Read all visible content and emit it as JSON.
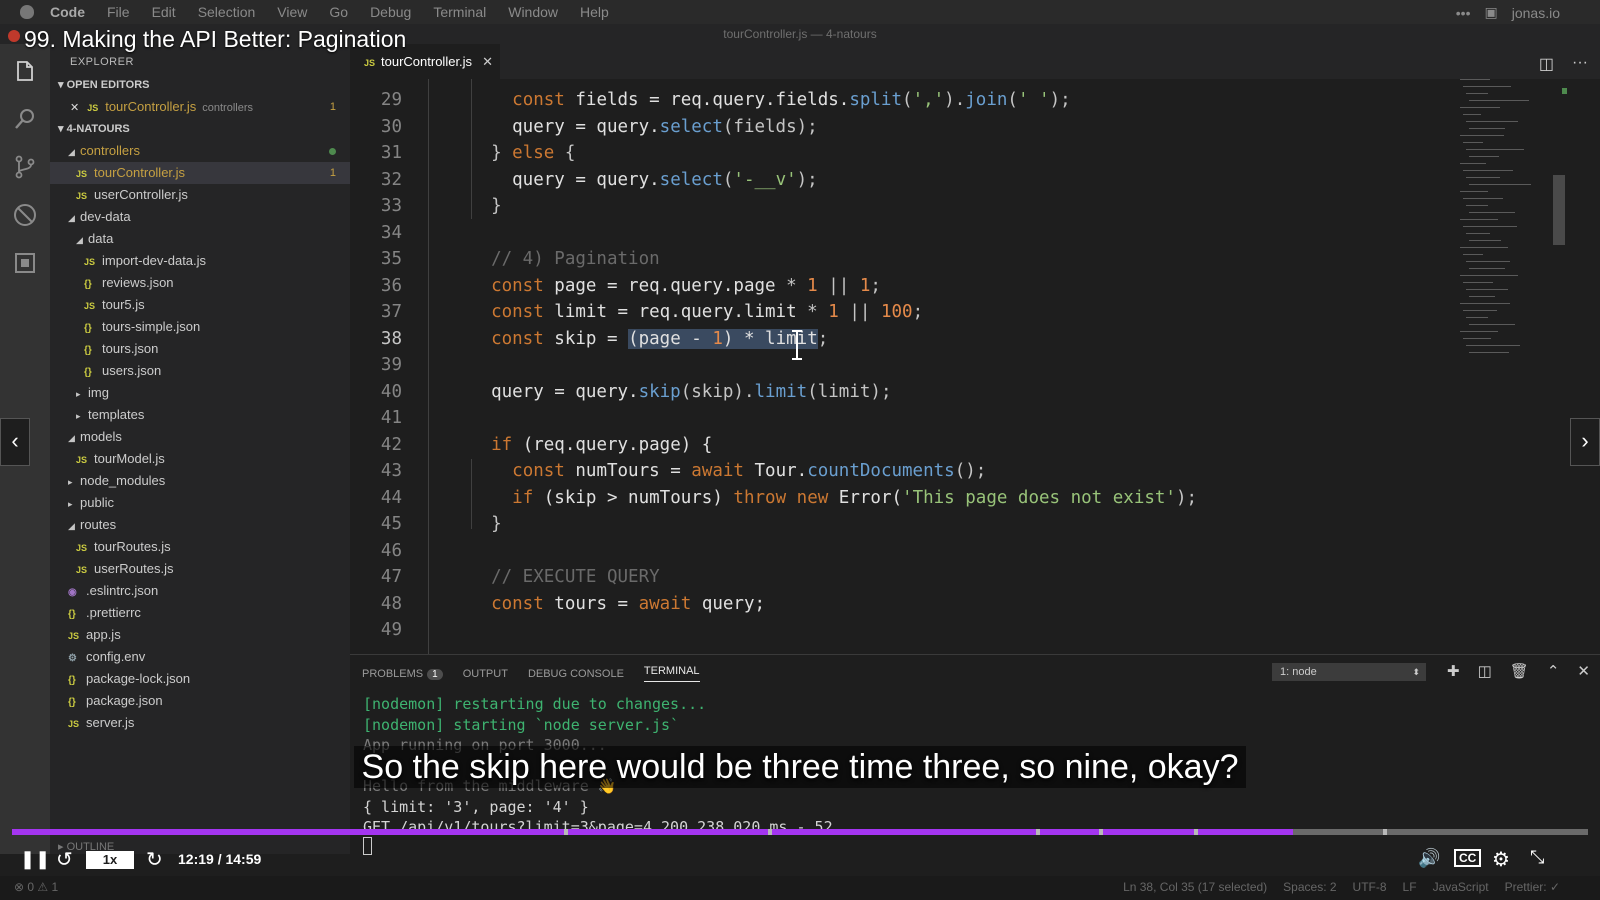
{
  "menubar": {
    "app": "Code",
    "items": [
      "File",
      "Edit",
      "Selection",
      "View",
      "Go",
      "Debug",
      "Terminal",
      "Window",
      "Help"
    ],
    "right_label": "jonas.io"
  },
  "window_title": "tourController.js — 4-natours",
  "video_title": "99. Making the API Better: Pagination",
  "sidebar": {
    "header": "EXPLORER",
    "open_editors_label": "OPEN EDITORS",
    "open_editors": [
      {
        "name": "tourController.js",
        "folder": "controllers",
        "count": "1"
      }
    ],
    "project_label": "4-NATOURS",
    "tree": [
      {
        "label": "controllers",
        "kind": "folder-open",
        "indent": 1,
        "modified": true
      },
      {
        "label": "tourController.js",
        "kind": "js",
        "indent": 2,
        "count": "1",
        "selected": true
      },
      {
        "label": "userController.js",
        "kind": "js",
        "indent": 2
      },
      {
        "label": "dev-data",
        "kind": "folder-open",
        "indent": 1
      },
      {
        "label": "data",
        "kind": "folder-open",
        "indent": 2
      },
      {
        "label": "import-dev-data.js",
        "kind": "js",
        "indent": 3
      },
      {
        "label": "reviews.json",
        "kind": "json",
        "indent": 3
      },
      {
        "label": "tour5.js",
        "kind": "js",
        "indent": 3
      },
      {
        "label": "tours-simple.json",
        "kind": "json",
        "indent": 3
      },
      {
        "label": "tours.json",
        "kind": "json",
        "indent": 3
      },
      {
        "label": "users.json",
        "kind": "json",
        "indent": 3
      },
      {
        "label": "img",
        "kind": "folder-closed",
        "indent": 2
      },
      {
        "label": "templates",
        "kind": "folder-closed",
        "indent": 2
      },
      {
        "label": "models",
        "kind": "folder-open",
        "indent": 1
      },
      {
        "label": "tourModel.js",
        "kind": "js",
        "indent": 2
      },
      {
        "label": "node_modules",
        "kind": "folder-closed",
        "indent": 1
      },
      {
        "label": "public",
        "kind": "folder-closed",
        "indent": 1
      },
      {
        "label": "routes",
        "kind": "folder-open",
        "indent": 1
      },
      {
        "label": "tourRoutes.js",
        "kind": "js",
        "indent": 2
      },
      {
        "label": "userRoutes.js",
        "kind": "js",
        "indent": 2
      },
      {
        "label": ".eslintrc.json",
        "kind": "eslint",
        "indent": 1
      },
      {
        "label": ".prettierrc",
        "kind": "json",
        "indent": 1
      },
      {
        "label": "app.js",
        "kind": "js",
        "indent": 1
      },
      {
        "label": "config.env",
        "kind": "gear",
        "indent": 1
      },
      {
        "label": "package-lock.json",
        "kind": "json",
        "indent": 1
      },
      {
        "label": "package.json",
        "kind": "json",
        "indent": 1
      },
      {
        "label": "server.js",
        "kind": "js",
        "indent": 1
      }
    ],
    "outline_label": "OUTLINE"
  },
  "editor": {
    "tab_label": "tourController.js",
    "current_line": 38,
    "lines": [
      {
        "n": "29",
        "t": [
          [
            "    ",
            "op"
          ],
          [
            "const",
            "kw"
          ],
          [
            " fields = req.query.fields.",
            "vr"
          ],
          [
            "split",
            "fn"
          ],
          [
            "(",
            "op"
          ],
          [
            "','",
            "str"
          ],
          [
            ").",
            "op"
          ],
          [
            "join",
            "fn"
          ],
          [
            "(",
            "op"
          ],
          [
            "' '",
            "str"
          ],
          [
            ");",
            "op"
          ]
        ]
      },
      {
        "n": "30",
        "t": [
          [
            "    query = query.",
            "vr"
          ],
          [
            "select",
            "fn"
          ],
          [
            "(fields);",
            "op"
          ]
        ]
      },
      {
        "n": "31",
        "t": [
          [
            "  } ",
            "op"
          ],
          [
            "else",
            "kw"
          ],
          [
            " {",
            "op"
          ]
        ]
      },
      {
        "n": "32",
        "t": [
          [
            "    query = query.",
            "vr"
          ],
          [
            "select",
            "fn"
          ],
          [
            "(",
            "op"
          ],
          [
            "'-__v'",
            "str"
          ],
          [
            ");",
            "op"
          ]
        ]
      },
      {
        "n": "33",
        "t": [
          [
            "  }",
            "op"
          ]
        ]
      },
      {
        "n": "34",
        "t": []
      },
      {
        "n": "35",
        "t": [
          [
            "  // 4) Pagination",
            "cm"
          ]
        ]
      },
      {
        "n": "36",
        "t": [
          [
            "  ",
            "op"
          ],
          [
            "const",
            "kw"
          ],
          [
            " page = req.query.page ",
            "vr"
          ],
          [
            "*",
            "op"
          ],
          [
            " 1",
            "num"
          ],
          [
            " || ",
            "op"
          ],
          [
            "1",
            "num"
          ],
          [
            ";",
            "op"
          ]
        ]
      },
      {
        "n": "37",
        "t": [
          [
            "  ",
            "op"
          ],
          [
            "const",
            "kw"
          ],
          [
            " limit = req.query.limit ",
            "vr"
          ],
          [
            "*",
            "op"
          ],
          [
            " 1",
            "num"
          ],
          [
            " || ",
            "op"
          ],
          [
            "100",
            "num"
          ],
          [
            ";",
            "op"
          ]
        ]
      },
      {
        "n": "38",
        "t": [
          [
            "  ",
            "op"
          ],
          [
            "const",
            "kw"
          ],
          [
            " skip = ",
            "vr"
          ],
          [
            "(page - ",
            "sel-vr"
          ],
          [
            "1",
            "sel-num"
          ],
          [
            ") * limit",
            "sel-vr"
          ],
          [
            ";",
            "op"
          ]
        ]
      },
      {
        "n": "39",
        "t": []
      },
      {
        "n": "40",
        "t": [
          [
            "  query = query.",
            "vr"
          ],
          [
            "skip",
            "fn"
          ],
          [
            "(skip).",
            "op"
          ],
          [
            "limit",
            "fn"
          ],
          [
            "(limit);",
            "op"
          ]
        ]
      },
      {
        "n": "41",
        "t": []
      },
      {
        "n": "42",
        "t": [
          [
            "  ",
            "op"
          ],
          [
            "if",
            "kw"
          ],
          [
            " (req.query.page) {",
            "vr"
          ]
        ]
      },
      {
        "n": "43",
        "t": [
          [
            "    ",
            "op"
          ],
          [
            "const",
            "kw"
          ],
          [
            " numTours = ",
            "vr"
          ],
          [
            "await",
            "kw"
          ],
          [
            " Tour.",
            "vr"
          ],
          [
            "countDocuments",
            "fn"
          ],
          [
            "();",
            "op"
          ]
        ]
      },
      {
        "n": "44",
        "t": [
          [
            "    ",
            "op"
          ],
          [
            "if",
            "kw"
          ],
          [
            " (skip > numTours) ",
            "vr"
          ],
          [
            "throw",
            "kw"
          ],
          [
            " ",
            "op"
          ],
          [
            "new",
            "kw"
          ],
          [
            " Error(",
            "vr"
          ],
          [
            "'This page does not exist'",
            "str"
          ],
          [
            ");",
            "op"
          ]
        ]
      },
      {
        "n": "45",
        "t": [
          [
            "  }",
            "op"
          ]
        ]
      },
      {
        "n": "46",
        "t": []
      },
      {
        "n": "47",
        "t": [
          [
            "  // EXECUTE QUERY",
            "cm"
          ]
        ]
      },
      {
        "n": "48",
        "t": [
          [
            "  ",
            "op"
          ],
          [
            "const",
            "kw"
          ],
          [
            " tours = ",
            "vr"
          ],
          [
            "await",
            "kw"
          ],
          [
            " query;",
            "vr"
          ]
        ]
      },
      {
        "n": "49",
        "t": []
      }
    ]
  },
  "panel": {
    "tabs": [
      "PROBLEMS",
      "OUTPUT",
      "DEBUG CONSOLE",
      "TERMINAL"
    ],
    "problems_count": "1",
    "terminal_select": "1: node",
    "terminal_lines": [
      {
        "text": "[nodemon] restarting due to changes...",
        "style": "tgreen"
      },
      {
        "text": "[nodemon] starting `node server.js`",
        "style": "tgreen"
      },
      {
        "text": "App running on port 3000...",
        "style": "tgray"
      },
      {
        "text": "",
        "style": "tgray"
      },
      {
        "text": "Hello from the middleware 👋",
        "style": "tgray"
      },
      {
        "text": "{ limit: '3', page: '4' }",
        "style": "twhite"
      },
      {
        "text": "GET /api/v1/tours?limit=3&page=4 200 238.020 ms - 52",
        "style": "twhite"
      }
    ]
  },
  "subtitle": "So the skip here would be three time three, so nine, okay?",
  "statusbar": {
    "left": "⊗ 0 ⚠ 1",
    "position": "Ln 38, Col 35 (17 selected)",
    "spaces": "Spaces: 2",
    "encoding": "UTF-8",
    "eol": "LF",
    "language": "JavaScript",
    "formatter": "Prettier: ✓"
  },
  "player": {
    "speed": "1x",
    "time": "12:19 / 14:59",
    "progress": 0.813,
    "chapter_marks": [
      0.35,
      0.48,
      0.65,
      0.69,
      0.75,
      0.87
    ],
    "accent": "#a435f0"
  }
}
